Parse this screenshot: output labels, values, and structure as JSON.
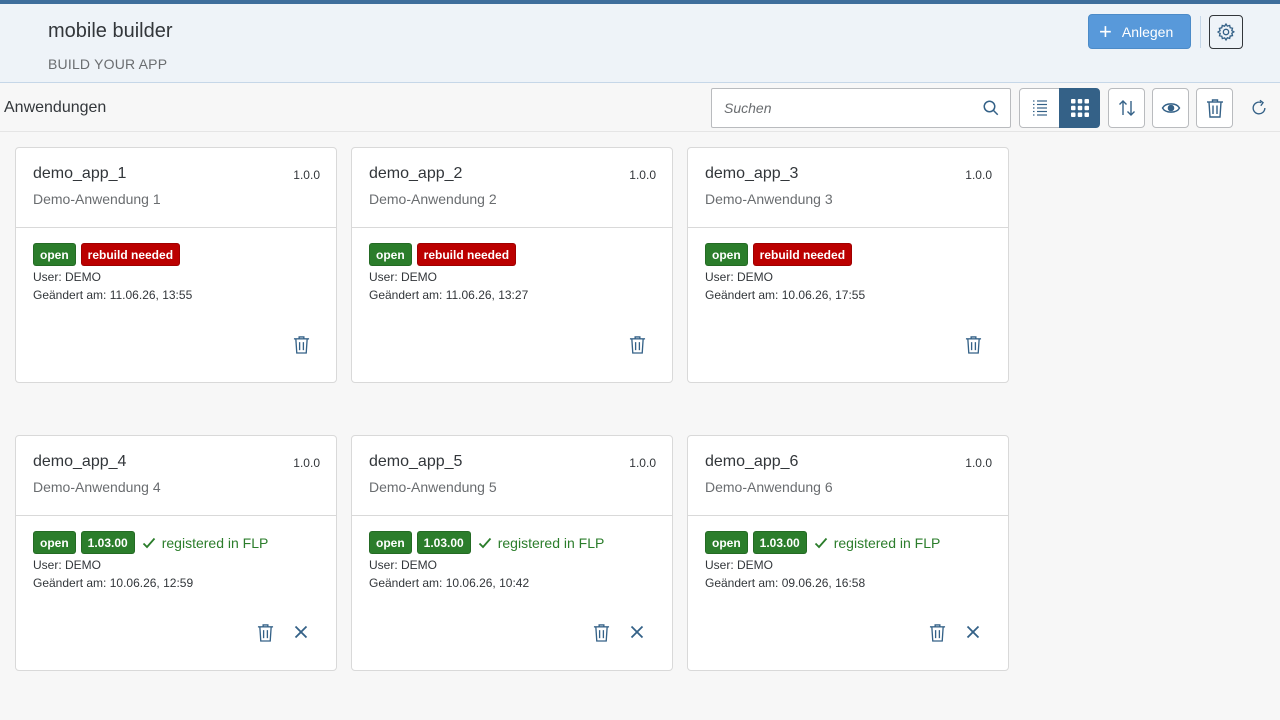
{
  "header": {
    "title": "mobile builder",
    "subtitle": "BUILD YOUR APP",
    "create_label": "Anlegen",
    "accent_color": "#5899da"
  },
  "toolbar": {
    "section_title": "Anwendungen",
    "search_placeholder": "Suchen",
    "search_value": "",
    "buttons": [
      "list-view-icon",
      "grid-view-icon",
      "sort-icon",
      "show-icon",
      "delete-icon",
      "refresh-icon"
    ],
    "active_view": "grid"
  },
  "labels": {
    "user_prefix": "User:",
    "date_prefix": "Geändert am:"
  },
  "status_colors": {
    "open": "#2b7d2b",
    "rebuild": "#bb0000"
  },
  "cards": [
    {
      "name": "demo_app_1",
      "version": "1.0.0",
      "description": "Demo-Anwendung 1",
      "status": "open",
      "badge2": "rebuild needed",
      "flp": "",
      "user": "DEMO",
      "changed": "11.06.26, 13:55"
    },
    {
      "name": "demo_app_2",
      "version": "1.0.0",
      "description": "Demo-Anwendung 2",
      "status": "open",
      "badge2": "rebuild needed",
      "flp": "",
      "user": "DEMO",
      "changed": "11.06.26, 13:27"
    },
    {
      "name": "demo_app_3",
      "version": "1.0.0",
      "description": "Demo-Anwendung 3",
      "status": "open",
      "badge2": "rebuild needed",
      "flp": "",
      "user": "DEMO",
      "changed": "10.06.26, 17:55"
    },
    {
      "name": "demo_app_4",
      "version": "1.0.0",
      "description": "Demo-Anwendung 4",
      "status": "open",
      "badge2": "1.03.00",
      "flp": "registered in FLP",
      "user": "DEMO",
      "changed": "10.06.26, 12:59"
    },
    {
      "name": "demo_app_5",
      "version": "1.0.0",
      "description": "Demo-Anwendung 5",
      "status": "open",
      "badge2": "1.03.00",
      "flp": "registered in FLP",
      "user": "DEMO",
      "changed": "10.06.26, 10:42"
    },
    {
      "name": "demo_app_6",
      "version": "1.0.0",
      "description": "Demo-Anwendung 6",
      "status": "open",
      "badge2": "1.03.00",
      "flp": "registered in FLP",
      "user": "DEMO",
      "changed": "09.06.26, 16:58"
    }
  ]
}
